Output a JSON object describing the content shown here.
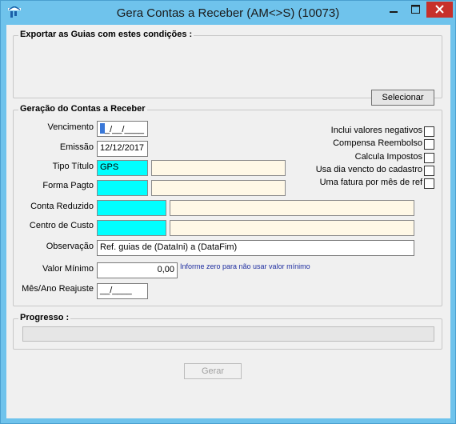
{
  "window": {
    "title": "Gera Contas a Receber (AM<>S) (10073)",
    "accent_color": "#6fc3ec",
    "close_color": "#c7302b",
    "icons": {
      "app": "app-icon",
      "minimize": "minimize-icon",
      "maximize": "maximize-icon",
      "close": "close-icon"
    }
  },
  "export_group": {
    "title": "Exportar as Guias com estes condições :",
    "select_button": "Selecionar"
  },
  "generation_group": {
    "title": "Geração do Contas a Receber",
    "vencimento": {
      "label": "Vencimento",
      "value": "_/__/____"
    },
    "emissao": {
      "label": "Emissão",
      "value": "12/12/2017"
    },
    "tipo_titulo": {
      "label": "Tipo Título",
      "code": "GPS",
      "description": ""
    },
    "forma_pagto": {
      "label": "Forma Pagto",
      "code": "",
      "description": ""
    },
    "conta_reduzido": {
      "label": "Conta Reduzido",
      "code": "",
      "description": ""
    },
    "centro_custo": {
      "label": "Centro de Custo",
      "code": "",
      "description": ""
    },
    "observacao": {
      "label": "Observação",
      "value": "Ref. guias de (DataIni) a (DataFim)"
    },
    "valor_minimo": {
      "label": "Valor Mínimo",
      "value": "0,00",
      "hint": "Informe zero para não usar valor mínimo"
    },
    "mes_ano_reajuste": {
      "label": "Mês/Ano Reajuste",
      "value": "__/____"
    },
    "checkboxes": [
      {
        "label": "Inclui valores negativos",
        "checked": false
      },
      {
        "label": "Compensa Reembolso",
        "checked": false
      },
      {
        "label": "Calcula Impostos",
        "checked": false
      },
      {
        "label": "Usa dia vencto do cadastro",
        "checked": false
      },
      {
        "label": "Uma fatura por mês de ref",
        "checked": false
      }
    ],
    "field_colors": {
      "code": "#00ffff",
      "description": "#fff8e6"
    }
  },
  "progress_group": {
    "title": "Progresso :",
    "progress": 0
  },
  "footer": {
    "generate_button": "Gerar"
  }
}
